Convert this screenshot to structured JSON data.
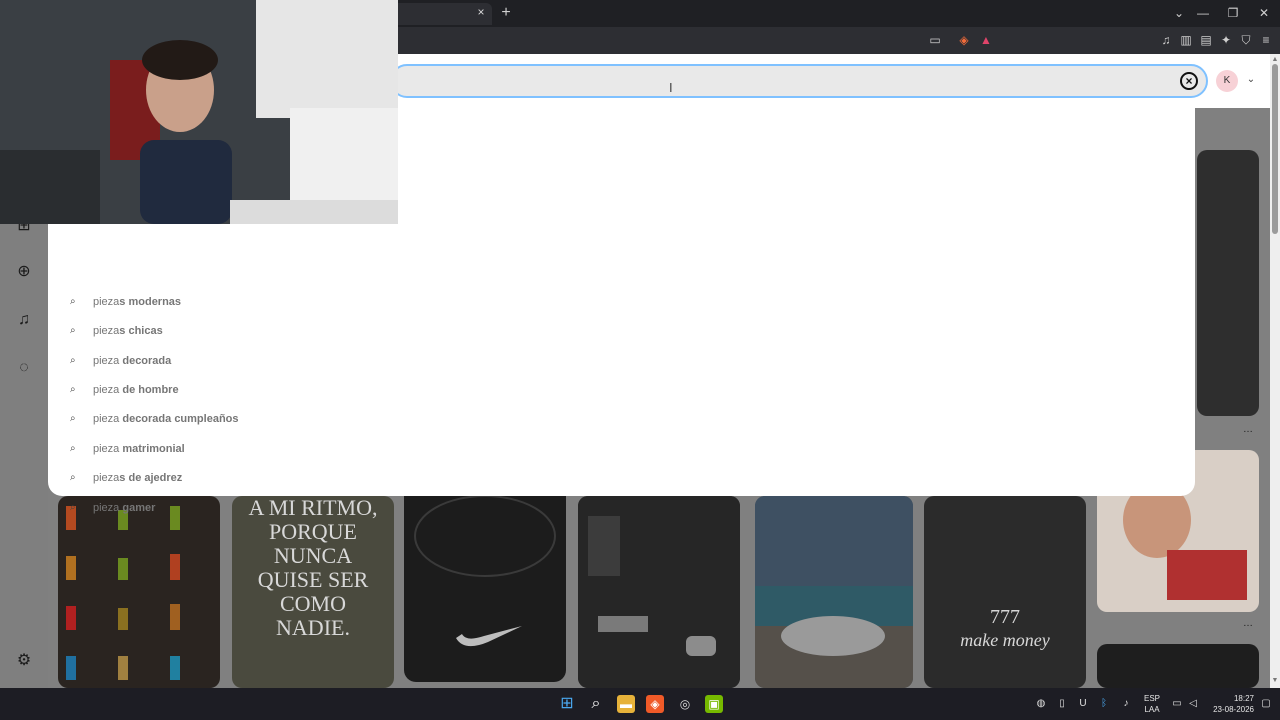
{
  "browser": {
    "tab_close": "×",
    "new_tab": "+",
    "window_controls": [
      "⌄",
      "—",
      "❐",
      "✕"
    ]
  },
  "search": {
    "value": "",
    "clear_label": "×",
    "avatar_initial": "K",
    "account_chevron": "⌄"
  },
  "suggestions": [
    {
      "typed": "pieza",
      "rest": "s modernas"
    },
    {
      "typed": "pieza",
      "rest": "s chicas"
    },
    {
      "typed": "pieza",
      "rest": " decorada"
    },
    {
      "typed": "pieza",
      "rest": " de hombre"
    },
    {
      "typed": "pieza",
      "rest": " decorada cumpleaños"
    },
    {
      "typed": "pieza",
      "rest": " matrimonial"
    },
    {
      "typed": "pieza",
      "rest": "s de ajedrez"
    },
    {
      "typed": "pieza",
      "rest": " gamer"
    }
  ],
  "pins": {
    "motivational_text": "A MI RITMO, PORQUE NUNCA QUISE SER COMO NADIE.",
    "money_number": "777",
    "money_text": "make money",
    "more_label": "…"
  },
  "taskbar": {
    "language_top": "ESP",
    "language_bottom": "LAA",
    "time": "18:27",
    "date": "23-08-2026"
  },
  "colors": {
    "accent_focus": "#7fc1ff",
    "avatar_bg": "#f7d1d6",
    "overlay": "#808080"
  }
}
